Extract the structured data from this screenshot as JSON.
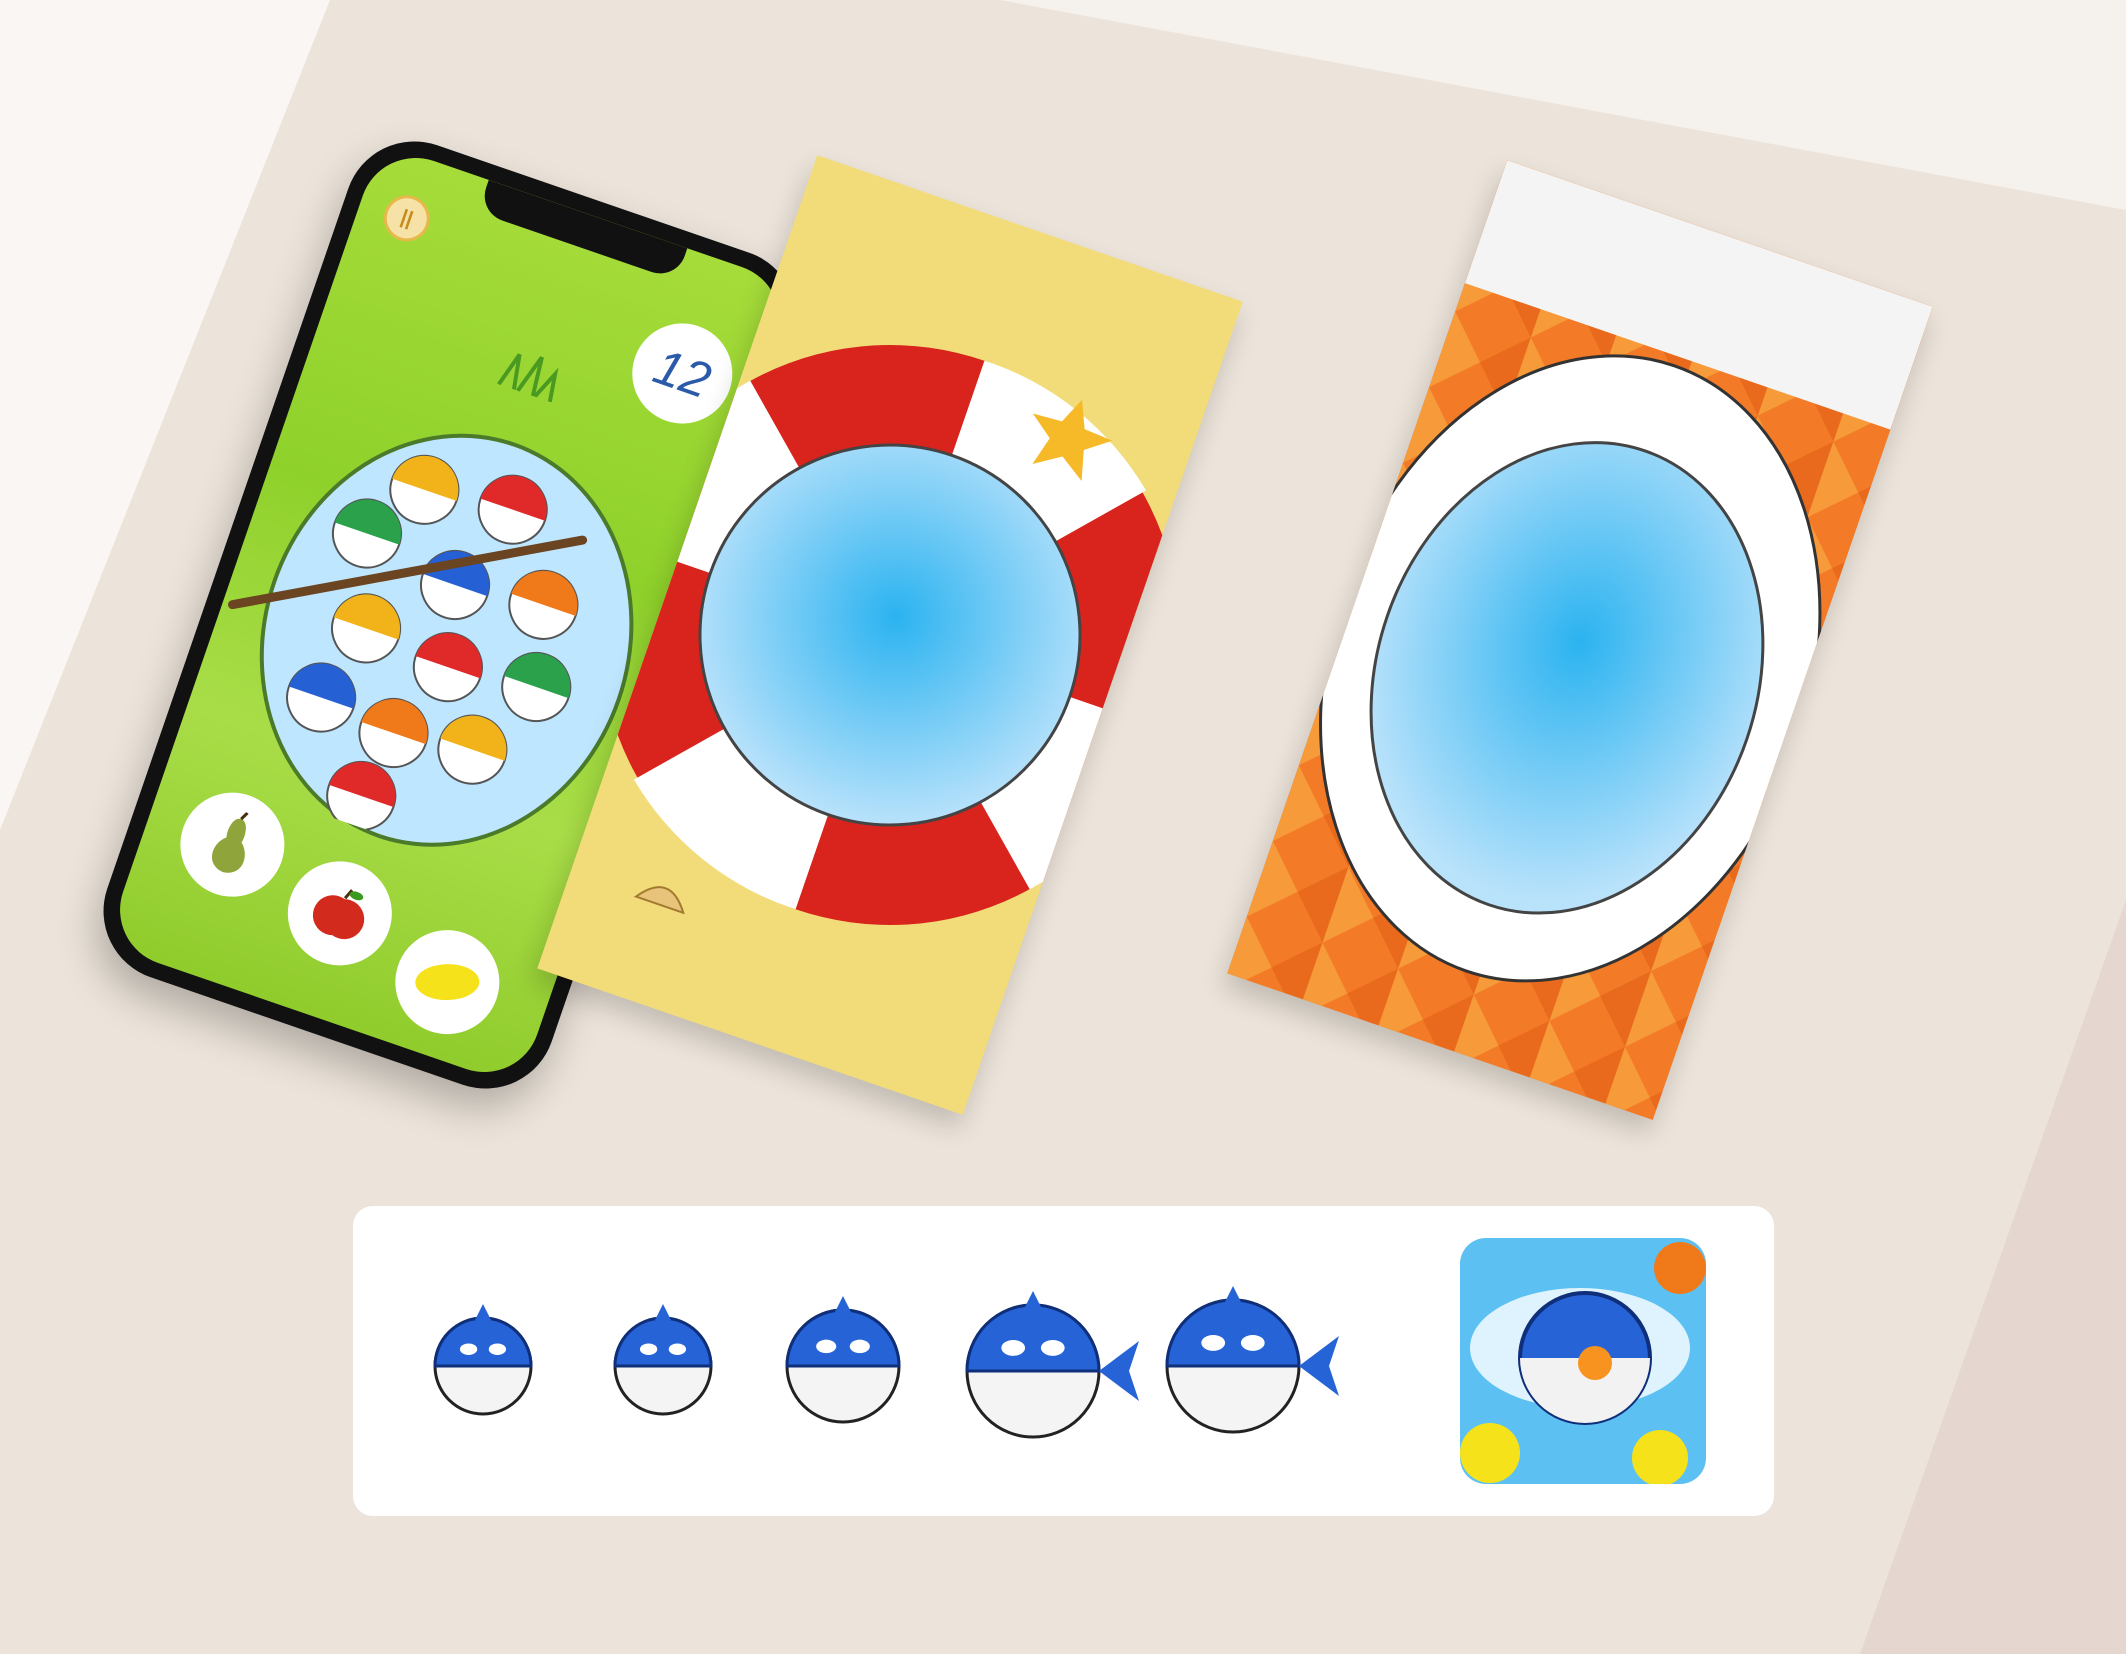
{
  "game": {
    "score": "12",
    "pause_icon": "pause-icon",
    "fruit_buttons": [
      {
        "name": "pear",
        "icon": "pear-icon",
        "color": "#8fa43a"
      },
      {
        "name": "apple",
        "icon": "apple-icon",
        "color": "#d22a1c"
      },
      {
        "name": "lemon",
        "icon": "lemon-icon",
        "color": "#f6e21a"
      }
    ],
    "fish_colors": [
      "#ffffff",
      "#f2b21a",
      "#e02a2a",
      "#2aa14a",
      "#2560d4",
      "#f07a1a"
    ]
  },
  "backgrounds": [
    {
      "name": "lifebuoy-beach",
      "palette": [
        "#f2dc7a",
        "#d8241c",
        "#ffffff",
        "#7ec9f4"
      ]
    },
    {
      "name": "toilet-tiles",
      "palette": [
        "#f37a26",
        "#ffffff",
        "#7ec9f4"
      ]
    }
  ],
  "character_sheet": {
    "character": "blue-fish",
    "stages": [
      "fish-stage-1",
      "fish-stage-2",
      "fish-stage-3",
      "fish-stage-4",
      "fish-stage-5",
      "app-icon"
    ],
    "color": "#2563d6"
  }
}
